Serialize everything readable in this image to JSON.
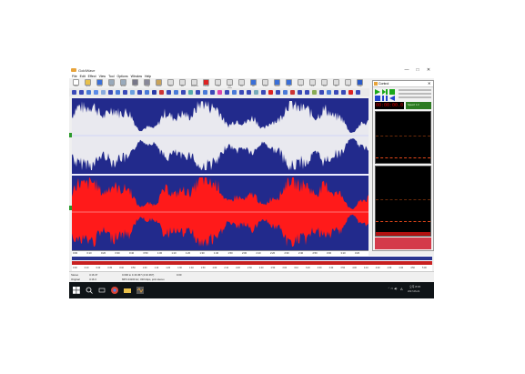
{
  "app": {
    "title": "GoldWave",
    "window_buttons": [
      "—",
      "□",
      "✕"
    ]
  },
  "menu": [
    "File",
    "Edit",
    "Effect",
    "View",
    "Tool",
    "Options",
    "Window",
    "Help"
  ],
  "toolbar": [
    {
      "label": "New",
      "icon": "new-file-icon",
      "color": "#ffffff"
    },
    {
      "label": "Open",
      "icon": "open-folder-icon",
      "color": "#e8c04a"
    },
    {
      "label": "Save",
      "icon": "save-icon",
      "color": "#3a6fd8"
    },
    {
      "label": "Undo",
      "icon": "undo-icon",
      "color": "#9ab"
    },
    {
      "label": "Redo",
      "icon": "redo-icon",
      "color": "#9ab"
    },
    {
      "label": "Cut",
      "icon": "scissors-icon",
      "color": "#778"
    },
    {
      "label": "Copy",
      "icon": "copy-icon",
      "color": "#889"
    },
    {
      "label": "Paste",
      "icon": "paste-icon",
      "color": "#c9a35a"
    },
    {
      "label": "New",
      "icon": "paste-new-icon",
      "color": "#ddd"
    },
    {
      "label": "Mix",
      "icon": "mix-icon",
      "color": "#ddd"
    },
    {
      "label": "Replace",
      "icon": "replace-icon",
      "color": "#ddd"
    },
    {
      "label": "Delete",
      "icon": "delete-icon",
      "color": "#d22"
    },
    {
      "label": "Trim",
      "icon": "trim-icon",
      "color": "#ddd"
    },
    {
      "label": "Sel View",
      "icon": "select-view-icon",
      "color": "#ddd"
    },
    {
      "label": "Set",
      "icon": "set-marker-icon",
      "color": "#ddd"
    },
    {
      "label": "All",
      "icon": "select-all-icon",
      "color": "#3a6fd8"
    },
    {
      "label": "Prev",
      "icon": "prev-icon",
      "color": "#ddd"
    },
    {
      "label": "Zoom",
      "icon": "zoom-in-icon",
      "color": "#3a6fd8"
    },
    {
      "label": "Out",
      "icon": "zoom-out-icon",
      "color": "#3a6fd8"
    },
    {
      "label": "1:1",
      "icon": "zoom-fit-icon",
      "color": "#ddd"
    },
    {
      "label": "Full",
      "icon": "zoom-full-icon",
      "color": "#ddd"
    },
    {
      "label": "Tool",
      "icon": "tool-icon",
      "color": "#ddd"
    },
    {
      "label": "Eff",
      "icon": "effect-icon",
      "color": "#ddd"
    },
    {
      "label": "Cue",
      "icon": "cue-icon",
      "color": "#ddd"
    },
    {
      "label": "Help",
      "icon": "help-icon",
      "color": "#2a5ac8"
    }
  ],
  "effects_toolbar": [
    "#3a49b8",
    "#3a49b8",
    "#4a7ad8",
    "#5a8ae8",
    "#8ad",
    "#3a49b8",
    "#4a7ad8",
    "#3a49b8",
    "#6aa0e0",
    "#3a49b8",
    "#4a7ad8",
    "#2a3aa8",
    "#c33",
    "#3a49b8",
    "#4a7ad8",
    "#3a49b8",
    "#5aa",
    "#3a49b8",
    "#4a7ad8",
    "#3a49b8",
    "#d4a",
    "#3a49b8",
    "#4a7ad8",
    "#3a49b8",
    "#3a49b8",
    "#7ab",
    "#3a49b8",
    "#d22",
    "#3a49b8",
    "#4a7ad8",
    "#c33",
    "#3a49b8",
    "#3a49b8",
    "#8a5",
    "#3a49b8",
    "#4a7ad8",
    "#3a49b8",
    "#3a49b8",
    "#d22",
    "#3a49b8"
  ],
  "ruler_ticks": [
    "0:00",
    "0:10",
    "0:20",
    "0:30",
    "0:40",
    "0:50",
    "1:00",
    "1:10",
    "1:20",
    "1:30",
    "1:40",
    "1:50",
    "2:00",
    "2:10",
    "2:20",
    "2:30",
    "2:40",
    "2:50",
    "3:00",
    "3:10",
    "3:20"
  ],
  "overview_ticks": [
    "0:00",
    "0:10",
    "0:20",
    "0:30",
    "0:40",
    "0:50",
    "1:00",
    "1:10",
    "1:20",
    "1:30",
    "1:40",
    "1:50",
    "2:00",
    "2:10",
    "2:20",
    "2:30",
    "2:40",
    "2:50",
    "3:00",
    "3:10",
    "3:20",
    "3:30",
    "3:40",
    "3:50",
    "4:00",
    "4:10",
    "4:20",
    "4:30",
    "4:40",
    "4:50",
    "5:00"
  ],
  "status": {
    "channel": "Stereo",
    "length": "4:16.37",
    "selection": "0.000 to 4:16.367 (4:16.367)",
    "position": "0.00",
    "format": "Original",
    "zoom": "4:16.3",
    "codec": "MP3 44100 Hz, 320 kbps, joint stereo"
  },
  "control": {
    "title": "Control",
    "time": "00:00:00.0",
    "speed_label": "Speed: 1.0"
  },
  "taskbar": {
    "time": "오후 8:15",
    "date": "2017-06-21",
    "lang": "A"
  },
  "colors": {
    "wave_bg": "#222a8c",
    "top_channel": "#e9e9ef",
    "bottom_channel": "#ff1a1a",
    "lcd_text": "#e60000"
  }
}
